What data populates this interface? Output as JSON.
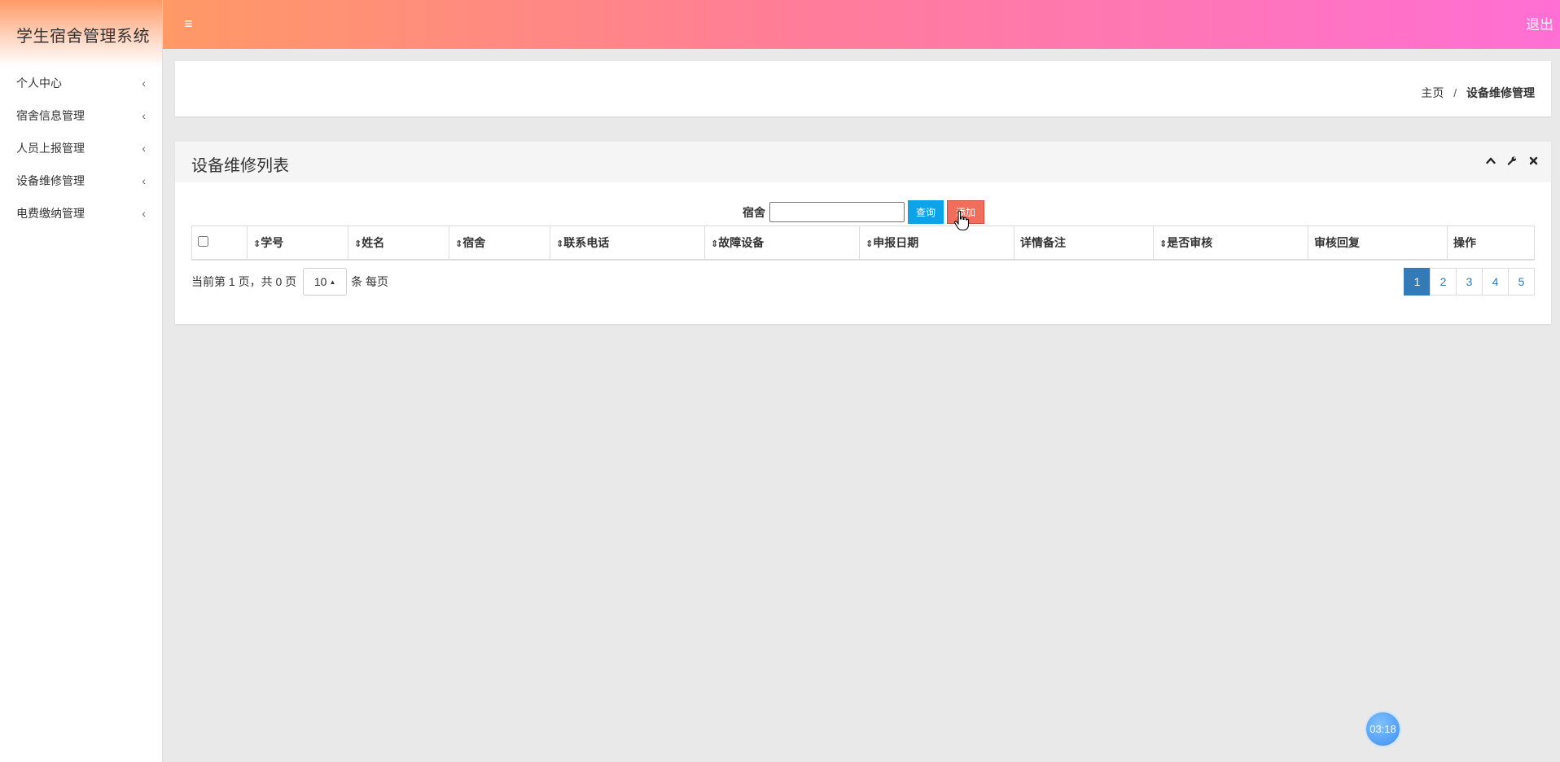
{
  "app": {
    "title": "学生宿舍管理系统",
    "logout_label": "退出"
  },
  "sidebar": {
    "items": [
      {
        "label": "个人中心"
      },
      {
        "label": "宿舍信息管理"
      },
      {
        "label": "人员上报管理"
      },
      {
        "label": "设备维修管理"
      },
      {
        "label": "电费缴纳管理"
      }
    ]
  },
  "breadcrumb": {
    "home": "主页",
    "separator": "/",
    "current": "设备维修管理"
  },
  "panel": {
    "title": "设备维修列表",
    "search_label": "宿舍",
    "search_value": "",
    "query_button": "查询",
    "add_button": "添加"
  },
  "table": {
    "columns": [
      {
        "label": "学号",
        "sortable": true
      },
      {
        "label": "姓名",
        "sortable": true
      },
      {
        "label": "宿舍",
        "sortable": true
      },
      {
        "label": "联系电话",
        "sortable": true
      },
      {
        "label": "故障设备",
        "sortable": true
      },
      {
        "label": "申报日期",
        "sortable": true
      },
      {
        "label": "详情备注",
        "sortable": false
      },
      {
        "label": "是否审核",
        "sortable": true
      },
      {
        "label": "审核回复",
        "sortable": false
      },
      {
        "label": "操作",
        "sortable": false
      }
    ],
    "rows": []
  },
  "footer": {
    "page_info": "当前第 1 页，共 0 页",
    "page_size": "10",
    "per_page_suffix": "条 每页",
    "pages": [
      "1",
      "2",
      "3",
      "4",
      "5"
    ],
    "current_page": "1"
  },
  "timer": {
    "text": "03:18"
  },
  "colors": {
    "topbar_start": "#ff9966",
    "topbar_end": "#ff6fd4",
    "query_button": "#0da3e8",
    "add_button": "#f06e5b",
    "page_active": "#337ab7"
  }
}
